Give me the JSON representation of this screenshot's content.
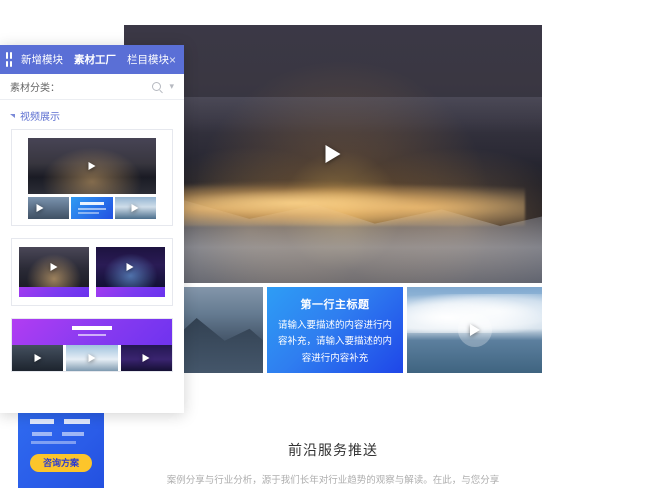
{
  "panel": {
    "header": {
      "grid_icon": "grid-icon",
      "tabs": [
        {
          "label": "新增模块",
          "active": false
        },
        {
          "label": "素材工厂",
          "active": true
        },
        {
          "label": "栏目模块",
          "active": false
        }
      ],
      "close_label": "×"
    },
    "search": {
      "label": "素材分类：",
      "search_icon": "search-icon",
      "collapse_icon": "double-chevron-down-icon"
    },
    "category": {
      "label": "视频展示",
      "expander_icon": "caret-right-icon"
    },
    "materials": [
      {
        "name": "视频展示-大图三小图"
      },
      {
        "name": "视频展示-双卡紫色标题"
      },
      {
        "name": "视频展示-紫色横幅三视频"
      }
    ]
  },
  "canvas": {
    "hero": {
      "name": "夜景城市视频",
      "play_icon": "play-icon"
    },
    "cards": [
      {
        "type": "video",
        "name": "雪山视频",
        "play_icon": "play-icon"
      },
      {
        "type": "text",
        "title": "第一行主标题",
        "body": "请输入要描述的内容进行内容补充，请输入要描述的内容进行内容补充"
      },
      {
        "type": "video",
        "name": "海天云景视频",
        "play_icon": "play-icon"
      }
    ],
    "promo": {
      "button_label": "咨询方案"
    },
    "section": {
      "title": "前沿服务推送",
      "subtitle": "案例分享与行业分析，源于我们长年对行业趋势的观察与解读。在此，与您分享"
    }
  },
  "colors": {
    "panel_header": "#5a6fd6",
    "accent_blue": "#2350e0",
    "accent_purple": "#7b3bf0",
    "accent_yellow": "#fcc52b"
  }
}
